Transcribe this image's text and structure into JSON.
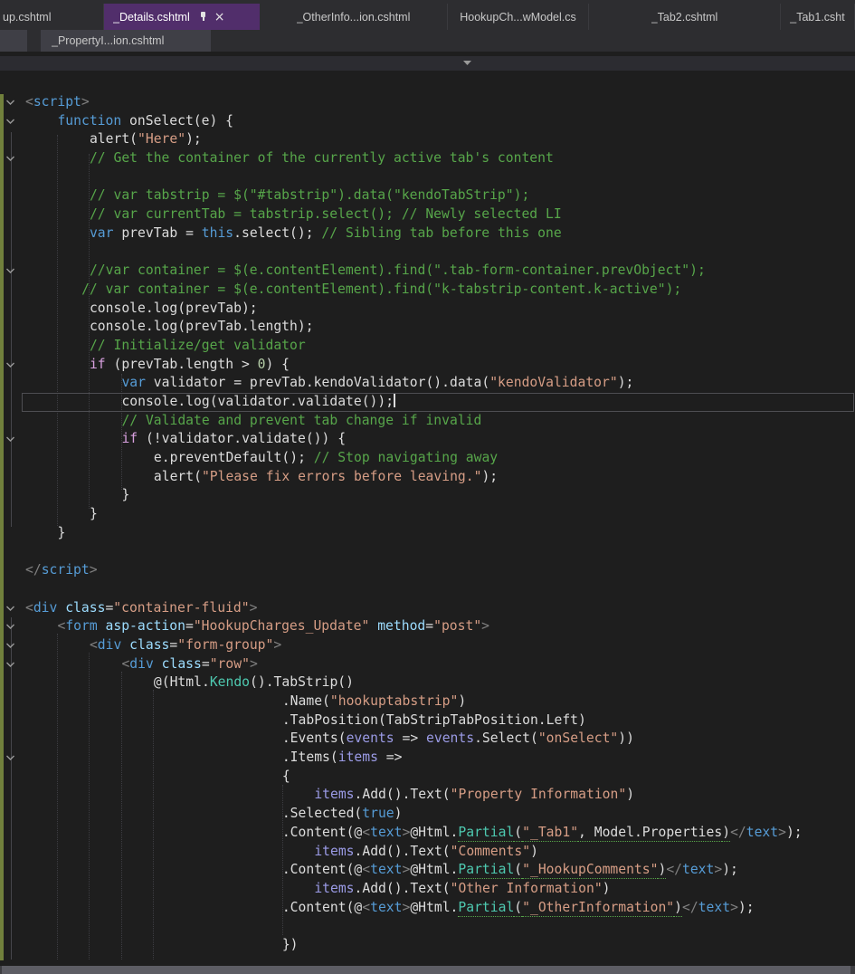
{
  "palette": {
    "editor_bg": "#1e1e1e",
    "tabwell_bg": "#2d2d30",
    "active_tab_bg": "#512e6b",
    "provisional_tab_bg": "#3f3f46",
    "tab_text": "#c8c8c8",
    "active_tab_text": "#ffffff",
    "fg": "#dcdcdc",
    "kw": "#569cd6",
    "ctrl": "#d8a0df",
    "str": "#d69d85",
    "com": "#57a64a",
    "num": "#b5cea8",
    "brk": "#808080",
    "attr": "#9cdcfe",
    "param": "#9b9be6",
    "teal": "#4ec9b0",
    "changebar": "#71803c",
    "caret_line_border": "#4e4e52",
    "indent_guide": "#3d3d42"
  },
  "tab_bar": {
    "row1": [
      {
        "label": "up.cshtml"
      },
      {
        "label": "_Details.cshtml",
        "active": true,
        "pinned": true,
        "closable": true
      },
      {
        "label": "_OtherInfo...ion.cshtml"
      },
      {
        "label": "HookupCh...wModel.cs"
      },
      {
        "label": "_Tab2.cshtml"
      },
      {
        "label": "_Tab1.csht"
      }
    ],
    "row2": [
      {
        "label": "_PropertyI...ion.cshtml",
        "provisional": true
      }
    ]
  },
  "editor": {
    "lines": [
      {
        "fold": true,
        "indent": 0,
        "tokens": [
          [
            "<",
            "brk"
          ],
          [
            "script",
            "kw"
          ],
          [
            ">",
            "brk"
          ]
        ]
      },
      {
        "fold": true,
        "indent": 4,
        "tokens": [
          [
            "function",
            "kw"
          ],
          [
            " onSelect(e) {",
            "def"
          ]
        ]
      },
      {
        "indent": 8,
        "tokens": [
          [
            "alert(",
            "def"
          ],
          [
            "\"Here\"",
            "str"
          ],
          [
            ");",
            "def"
          ]
        ]
      },
      {
        "fold": true,
        "indent": 8,
        "tokens": [
          [
            "// Get the container of the currently active tab's content",
            "com"
          ]
        ]
      },
      {
        "tokens": []
      },
      {
        "indent": 8,
        "tokens": [
          [
            "// var tabstrip = $(\"#tabstrip\").data(\"kendoTabStrip\");",
            "com"
          ]
        ]
      },
      {
        "indent": 8,
        "tokens": [
          [
            "// var currentTab = tabstrip.select(); // Newly selected LI",
            "com"
          ]
        ]
      },
      {
        "indent": 8,
        "tokens": [
          [
            "var",
            "kw"
          ],
          [
            " prevTab = ",
            "def"
          ],
          [
            "this",
            "kw"
          ],
          [
            ".select(); ",
            "def"
          ],
          [
            "// Sibling tab before this one",
            "com"
          ]
        ]
      },
      {
        "tokens": []
      },
      {
        "fold": true,
        "indent": 8,
        "tokens": [
          [
            "//var container = $(e.contentElement).find(\".tab-form-container.prevObject\");",
            "com"
          ]
        ]
      },
      {
        "indent": 7,
        "tokens": [
          [
            "// var container = $(e.contentElement).find(\"k-tabstrip-content.k-active\");",
            "com"
          ]
        ]
      },
      {
        "indent": 8,
        "tokens": [
          [
            "console.log(prevTab);",
            "def"
          ]
        ]
      },
      {
        "indent": 8,
        "tokens": [
          [
            "console.log(prevTab.length);",
            "def"
          ]
        ]
      },
      {
        "indent": 8,
        "tokens": [
          [
            "// Initialize/get validator",
            "com"
          ]
        ]
      },
      {
        "fold": true,
        "indent": 8,
        "tokens": [
          [
            "if",
            "ctrl"
          ],
          [
            " (prevTab.length > ",
            "def"
          ],
          [
            "0",
            "num"
          ],
          [
            ") {",
            "def"
          ]
        ]
      },
      {
        "indent": 12,
        "tokens": [
          [
            "var",
            "kw"
          ],
          [
            " validator = prevTab.kendoValidator().data(",
            "def"
          ],
          [
            "\"kendoValidator\"",
            "str"
          ],
          [
            ");",
            "def"
          ]
        ]
      },
      {
        "indent": 12,
        "caret": true,
        "tokens": [
          [
            "console.log(validator.validate());",
            "def"
          ]
        ]
      },
      {
        "indent": 12,
        "tokens": [
          [
            "// Validate and prevent tab change if invalid",
            "com"
          ]
        ]
      },
      {
        "fold": true,
        "indent": 12,
        "tokens": [
          [
            "if",
            "ctrl"
          ],
          [
            " (!validator.validate()) {",
            "def"
          ]
        ]
      },
      {
        "indent": 16,
        "tokens": [
          [
            "e.preventDefault(); ",
            "def"
          ],
          [
            "// Stop navigating away",
            "com"
          ]
        ]
      },
      {
        "indent": 16,
        "tokens": [
          [
            "alert(",
            "def"
          ],
          [
            "\"Please fix errors before leaving.\"",
            "str"
          ],
          [
            ");",
            "def"
          ]
        ]
      },
      {
        "indent": 12,
        "tokens": [
          [
            "}",
            "def"
          ]
        ]
      },
      {
        "indent": 8,
        "tokens": [
          [
            "}",
            "def"
          ]
        ]
      },
      {
        "indent": 4,
        "tokens": [
          [
            "}",
            "def"
          ]
        ]
      },
      {
        "tokens": []
      },
      {
        "indent": 0,
        "tokens": [
          [
            "</",
            "brk"
          ],
          [
            "script",
            "kw"
          ],
          [
            ">",
            "brk"
          ]
        ]
      },
      {
        "tokens": []
      },
      {
        "fold": true,
        "indent": 0,
        "tokens": [
          [
            "<",
            "brk"
          ],
          [
            "div",
            "kw"
          ],
          [
            " ",
            "def"
          ],
          [
            "class",
            "attr"
          ],
          [
            "=",
            "def"
          ],
          [
            "\"container-fluid\"",
            "str"
          ],
          [
            ">",
            "brk"
          ]
        ]
      },
      {
        "fold": true,
        "indent": 4,
        "tokens": [
          [
            "<",
            "brk"
          ],
          [
            "form",
            "kw"
          ],
          [
            " ",
            "def"
          ],
          [
            "asp-action",
            "attr"
          ],
          [
            "=",
            "def"
          ],
          [
            "\"HookupCharges_Update\"",
            "str"
          ],
          [
            " ",
            "def"
          ],
          [
            "method",
            "attr"
          ],
          [
            "=",
            "def"
          ],
          [
            "\"post\"",
            "str"
          ],
          [
            ">",
            "brk"
          ]
        ]
      },
      {
        "fold": true,
        "indent": 8,
        "tokens": [
          [
            "<",
            "brk"
          ],
          [
            "div",
            "kw"
          ],
          [
            " ",
            "def"
          ],
          [
            "class",
            "attr"
          ],
          [
            "=",
            "def"
          ],
          [
            "\"form-group\"",
            "str"
          ],
          [
            ">",
            "brk"
          ]
        ]
      },
      {
        "fold": true,
        "indent": 12,
        "tokens": [
          [
            "<",
            "brk"
          ],
          [
            "div",
            "kw"
          ],
          [
            " ",
            "def"
          ],
          [
            "class",
            "attr"
          ],
          [
            "=",
            "def"
          ],
          [
            "\"row\"",
            "str"
          ],
          [
            ">",
            "brk"
          ]
        ]
      },
      {
        "indent": 16,
        "tokens": [
          [
            "@(Html.",
            "def"
          ],
          [
            "Kendo",
            "teal"
          ],
          [
            "().TabStrip()",
            "def"
          ]
        ]
      },
      {
        "indent": 32,
        "tokens": [
          [
            ".Name(",
            "def"
          ],
          [
            "\"hookuptabstrip\"",
            "str"
          ],
          [
            ")",
            "def"
          ]
        ]
      },
      {
        "indent": 32,
        "tokens": [
          [
            ".TabPosition(TabStripTabPosition.Left)",
            "def"
          ]
        ]
      },
      {
        "indent": 32,
        "tokens": [
          [
            ".Events(",
            "def"
          ],
          [
            "events",
            "param"
          ],
          [
            " => ",
            "def"
          ],
          [
            "events",
            "param"
          ],
          [
            ".Select(",
            "def"
          ],
          [
            "\"onSelect\"",
            "str"
          ],
          [
            "))",
            "def"
          ]
        ]
      },
      {
        "fold": true,
        "indent": 32,
        "tokens": [
          [
            ".Items(",
            "def"
          ],
          [
            "items",
            "param"
          ],
          [
            " =>",
            "def"
          ]
        ]
      },
      {
        "indent": 32,
        "tokens": [
          [
            "{",
            "def"
          ]
        ]
      },
      {
        "indent": 36,
        "tokens": [
          [
            "items",
            "param"
          ],
          [
            ".Add().Text(",
            "def"
          ],
          [
            "\"Property Information\"",
            "str"
          ],
          [
            ")",
            "def"
          ]
        ]
      },
      {
        "indent": 32,
        "tokens": [
          [
            ".Selected(",
            "def"
          ],
          [
            "true",
            "kw"
          ],
          [
            ")",
            "def"
          ]
        ]
      },
      {
        "indent": 32,
        "tokens": [
          [
            ".Content(@",
            "def"
          ],
          [
            "<",
            "brk"
          ],
          [
            "text",
            "kw"
          ],
          [
            ">",
            "brk"
          ],
          [
            "@Html.",
            "def"
          ],
          [
            "Partial",
            "teal u"
          ],
          [
            "(",
            "def u"
          ],
          [
            "\"_Tab1\"",
            "str u"
          ],
          [
            ", Model.Properties",
            "def u"
          ],
          [
            ")",
            "def u"
          ],
          [
            "</",
            "brk"
          ],
          [
            "text",
            "kw"
          ],
          [
            ">",
            "brk"
          ],
          [
            ");",
            "def"
          ]
        ]
      },
      {
        "indent": 36,
        "tokens": [
          [
            "items",
            "param"
          ],
          [
            ".Add().Text(",
            "def"
          ],
          [
            "\"Comments\"",
            "str"
          ],
          [
            ")",
            "def"
          ]
        ]
      },
      {
        "indent": 32,
        "tokens": [
          [
            ".Content(@",
            "def"
          ],
          [
            "<",
            "brk"
          ],
          [
            "text",
            "kw"
          ],
          [
            ">",
            "brk"
          ],
          [
            "@Html.",
            "def"
          ],
          [
            "Partial",
            "teal u"
          ],
          [
            "(",
            "def u"
          ],
          [
            "\"_HookupComments\"",
            "str u"
          ],
          [
            ")",
            "def u"
          ],
          [
            "</",
            "brk"
          ],
          [
            "text",
            "kw"
          ],
          [
            ">",
            "brk"
          ],
          [
            ");",
            "def"
          ]
        ]
      },
      {
        "indent": 36,
        "tokens": [
          [
            "items",
            "param"
          ],
          [
            ".Add().Text(",
            "def"
          ],
          [
            "\"Other Information\"",
            "str"
          ],
          [
            ")",
            "def"
          ]
        ]
      },
      {
        "indent": 32,
        "tokens": [
          [
            ".Content(@",
            "def"
          ],
          [
            "<",
            "brk"
          ],
          [
            "text",
            "kw"
          ],
          [
            ">",
            "brk"
          ],
          [
            "@Html.",
            "def"
          ],
          [
            "Partial",
            "teal u"
          ],
          [
            "(",
            "def u"
          ],
          [
            "\"_OtherInformation\"",
            "str u"
          ],
          [
            ")",
            "def u"
          ],
          [
            "</",
            "brk"
          ],
          [
            "text",
            "kw"
          ],
          [
            ">",
            "brk"
          ],
          [
            ");",
            "def"
          ]
        ]
      },
      {
        "tokens": []
      },
      {
        "indent": 32,
        "tokens": [
          [
            "})",
            "def"
          ]
        ]
      }
    ]
  }
}
